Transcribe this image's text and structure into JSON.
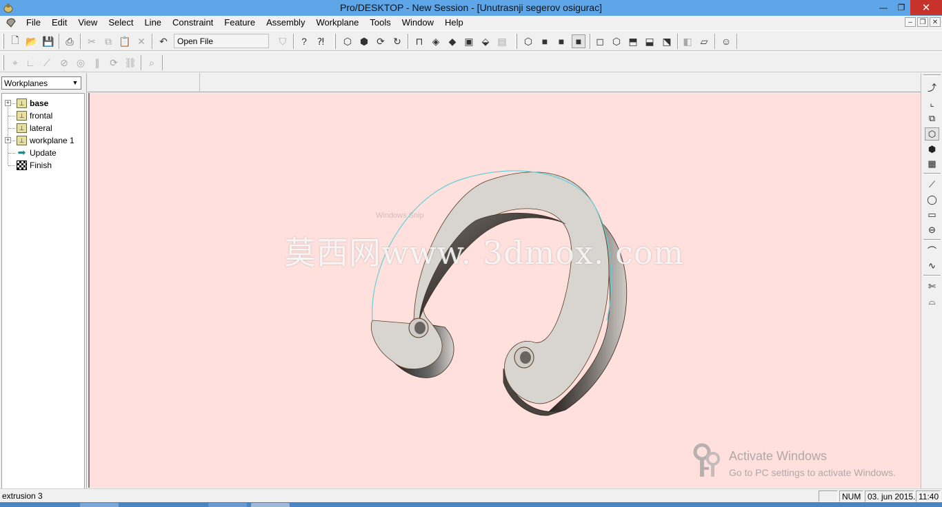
{
  "window": {
    "title": "Pro/DESKTOP - New Session - [Unutrasnji segerov osigurac]",
    "minimize_glyph": "—",
    "restore_glyph": "❐",
    "close_glyph": "✕"
  },
  "menu": {
    "items": [
      "File",
      "Edit",
      "View",
      "Select",
      "Line",
      "Constraint",
      "Feature",
      "Assembly",
      "Workplane",
      "Tools",
      "Window",
      "Help"
    ]
  },
  "toolbar": {
    "open_file_label": "Open File"
  },
  "browser": {
    "dropdown_value": "Workplanes",
    "tree": [
      {
        "label": "base",
        "bold": true,
        "expandable": true
      },
      {
        "label": "frontal",
        "bold": false,
        "expandable": false
      },
      {
        "label": "lateral",
        "bold": false,
        "expandable": false
      },
      {
        "label": "workplane 1",
        "bold": false,
        "expandable": true
      },
      {
        "label": "Update",
        "bold": false,
        "expandable": false
      },
      {
        "label": "Finish",
        "bold": false,
        "expandable": false
      }
    ]
  },
  "viewport": {
    "background": "#ffe0dc",
    "watermark": "莫西网www. 3dmox. com",
    "snip_hint": "Windows Snip",
    "activation_title": "Activate Windows",
    "activation_subtitle": "Go to PC settings to activate Windows."
  },
  "status": {
    "message": "extrusion 3",
    "num": "NUM",
    "date": "03. jun 2015.",
    "time": "11:40"
  },
  "colors": {
    "titlebar": "#5ea6e8",
    "close": "#c7322b",
    "model_face": "#d8d4d0",
    "model_edge_highlight": "#5fd0d8"
  }
}
